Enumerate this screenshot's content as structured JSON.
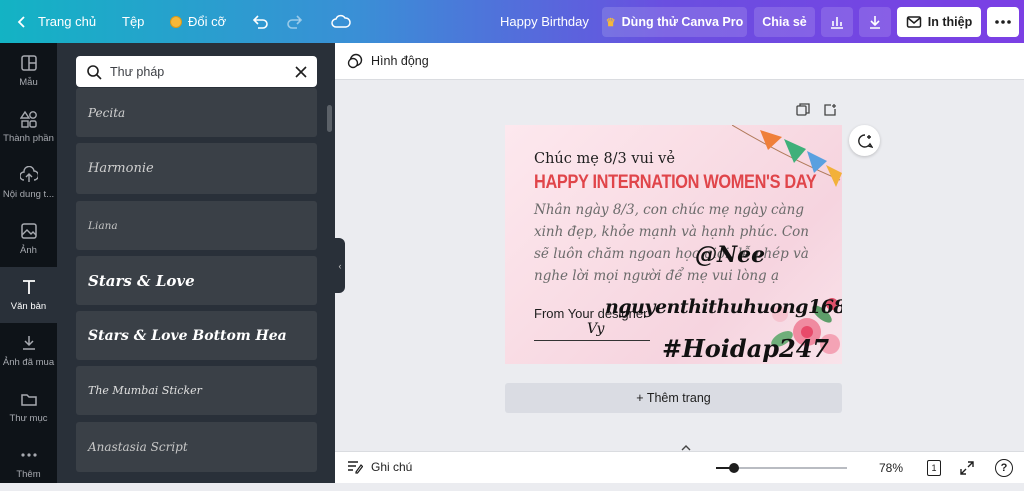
{
  "topbar": {
    "home": "Trang chủ",
    "file": "Tệp",
    "resize": "Đổi cỡ",
    "doc_title": "Happy Birthday",
    "try_pro": "Dùng thử Canva Pro",
    "share": "Chia sẻ",
    "print": "In thiệp"
  },
  "rail": {
    "items": [
      {
        "label": "Mẫu",
        "icon": "template-icon"
      },
      {
        "label": "Thành phần",
        "icon": "elements-icon"
      },
      {
        "label": "Nội dung t...",
        "icon": "upload-icon"
      },
      {
        "label": "Ảnh",
        "icon": "photo-icon"
      },
      {
        "label": "Văn bản",
        "icon": "text-icon"
      },
      {
        "label": "Ảnh đã mua",
        "icon": "purchased-icon"
      },
      {
        "label": "Thư mục",
        "icon": "folder-icon"
      },
      {
        "label": "Thêm",
        "icon": "more-icon"
      }
    ]
  },
  "panel": {
    "search_value": "Thư pháp",
    "fonts": [
      "Pecita",
      "Harmonie",
      "Liana",
      "Stars & Love",
      "Stars & Love Bottom Hea",
      "The Mumbai Sticker",
      "Anastasia Script"
    ]
  },
  "subbar": {
    "animate": "Hình động"
  },
  "card": {
    "title": "Chúc mẹ 8/3 vui vẻ",
    "headline": "HAPPY INTERNATION WOMEN'S DAY",
    "body": "Nhân ngày 8/3, con chúc mẹ ngày càng xinh đẹp, khỏe mạnh và hạnh phúc. Con sẽ luôn chăm ngoan học giỏi, lễ phép và nghe lời mọi người để mẹ vui lòng ạ",
    "from": "From Your designer",
    "signature": "Vy",
    "watermark_nee": "@Nee",
    "watermark_user": "nguyenthithuhuong16880",
    "watermark_tag": "#Hoidap247"
  },
  "add_page": "+ Thêm trang",
  "bottombar": {
    "notes": "Ghi chú",
    "zoom": "78%",
    "page_count": "1"
  },
  "colors": {
    "accent_red": "#e0454a",
    "dark_panel": "#293039",
    "rail": "#0e1318"
  }
}
